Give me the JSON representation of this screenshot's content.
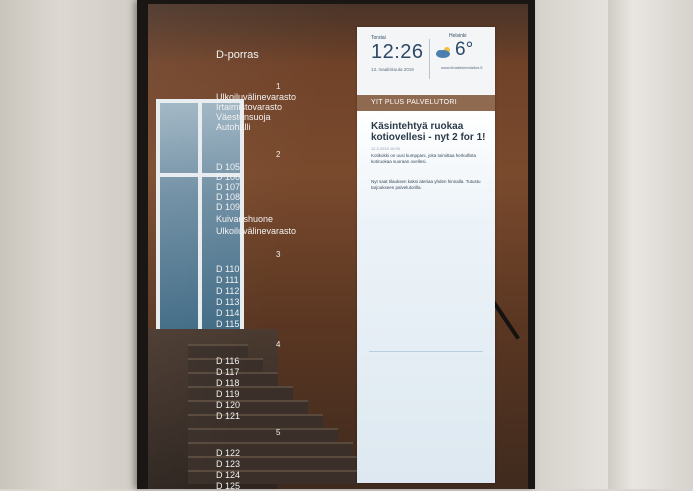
{
  "wayfinding": {
    "title": "D-porras",
    "floors": [
      "1",
      "2",
      "3",
      "4",
      "5"
    ],
    "floor1": [
      "Ulkoiluvälinevarasto",
      "Irtaimistovarasto",
      "Väestönsuoja",
      "Autohalli"
    ],
    "floor2": [
      "D 105",
      "D 106",
      "D 107",
      "D 108",
      "D 109",
      "Kuivaushuone",
      "Ulkoiluvälinevarasto"
    ],
    "floor3": [
      "D 110",
      "D 111",
      "D 112",
      "D 113",
      "D 114",
      "D 115"
    ],
    "floor4": [
      "D 116",
      "D 117",
      "D 118",
      "D 119",
      "D 120",
      "D 121"
    ],
    "floor5": [
      "D 122",
      "D 123",
      "D 124",
      "D 125"
    ]
  },
  "panel": {
    "clock_label": "Torstai",
    "time": "12:26",
    "date": "13. maaliskuuta 2019",
    "weather_label": "Helsinki",
    "temperature": "6°",
    "weather_source": "www.ilmatieteenlaitos.fi",
    "weather_icon": "cloud-sun-icon",
    "service_bar": "YIT PLUS PALVELUTORI",
    "headline": "Käsintehtyä ruokaa kotiovellesi - nyt 2 for 1!",
    "byline": "12.3.2019 10:00",
    "body1": "Kotikokki on uusi kumppani, joka toimittaa herkullista kotiruokaa suoraan ovellesi.",
    "body2": "Nyt saat tilauksen kaksi ateriaa yhden hinnalla. Tutustu tarjoukseen palvelutorilla."
  }
}
